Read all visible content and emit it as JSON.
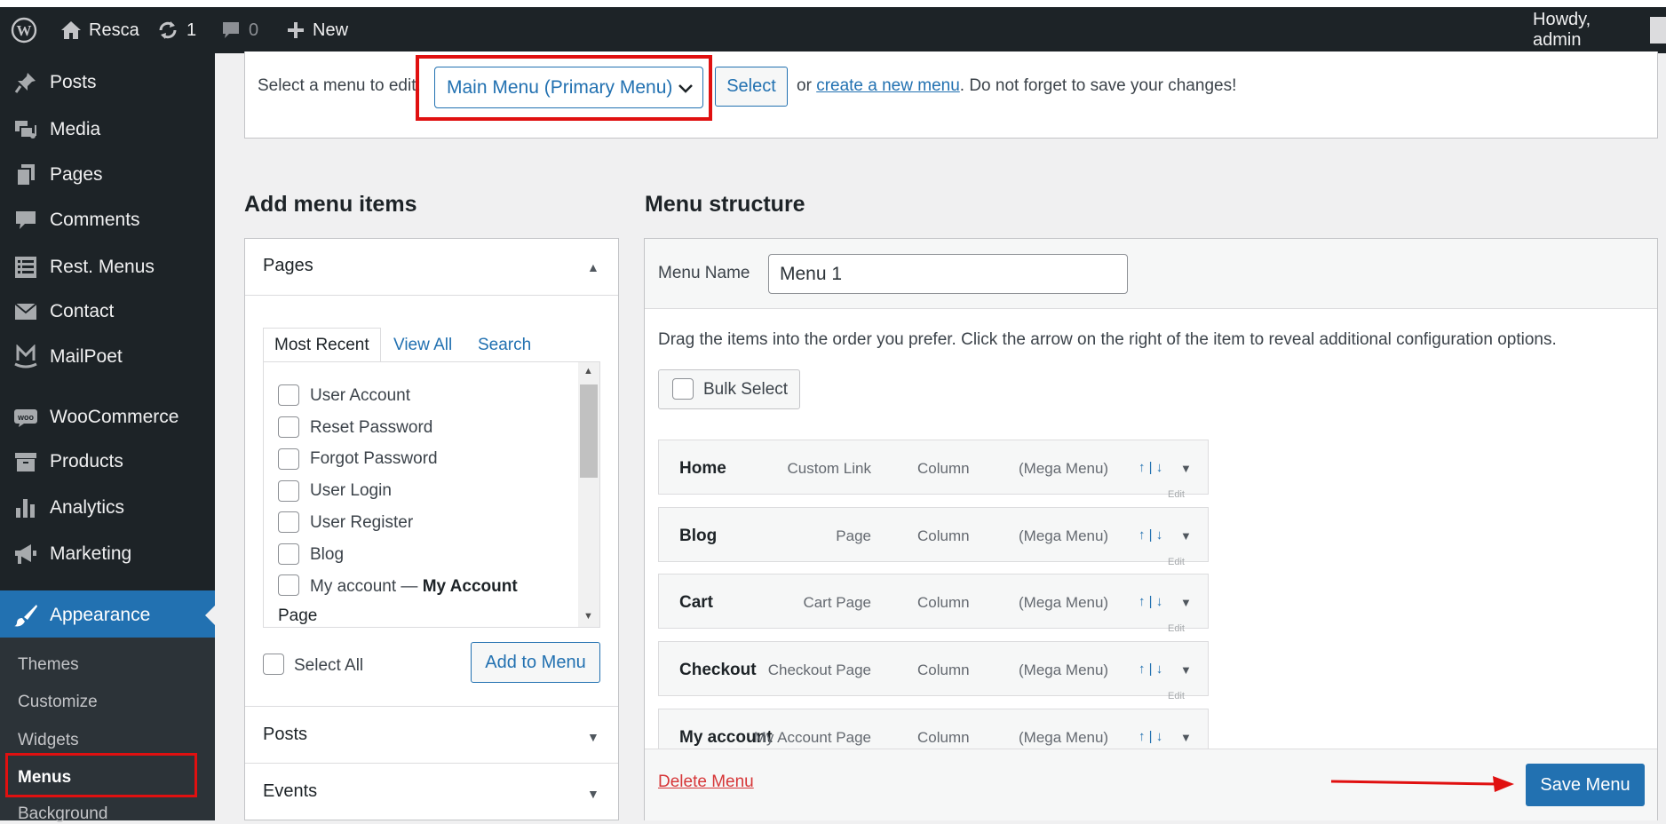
{
  "admin_bar": {
    "site_name": "Resca",
    "updates_count": "1",
    "comments_count": "0",
    "new_label": "New",
    "greeting": "Howdy, admin"
  },
  "sidebar": {
    "items": [
      {
        "label": "Posts",
        "icon": "pushpin-icon"
      },
      {
        "label": "Media",
        "icon": "media-icon"
      },
      {
        "label": "Pages",
        "icon": "pages-icon"
      },
      {
        "label": "Comments",
        "icon": "comments-icon"
      },
      {
        "label": "Rest. Menus",
        "icon": "list-icon"
      },
      {
        "label": "Contact",
        "icon": "envelope-icon"
      },
      {
        "label": "MailPoet",
        "icon": "mailpoet-icon"
      },
      {
        "label": "WooCommerce",
        "icon": "woo-icon"
      },
      {
        "label": "Products",
        "icon": "archive-icon"
      },
      {
        "label": "Analytics",
        "icon": "bar-chart-icon"
      },
      {
        "label": "Marketing",
        "icon": "megaphone-icon"
      },
      {
        "label": "Appearance",
        "icon": "brush-icon"
      }
    ],
    "submenu": [
      "Themes",
      "Customize",
      "Widgets",
      "Menus",
      "Background"
    ]
  },
  "menu_select": {
    "label": "Select a menu to edit:",
    "selected": "Main Menu (Primary Menu)",
    "select_button": "Select",
    "or_text": "or",
    "create_link": "create a new menu",
    "reminder": ". Do not forget to save your changes!"
  },
  "add_items": {
    "heading": "Add menu items",
    "pages_title": "Pages",
    "tabs": [
      "Most Recent",
      "View All",
      "Search"
    ],
    "pages": [
      "User Account",
      "Reset Password",
      "Forgot Password",
      "User Login",
      "User Register",
      "Blog",
      "My account — "
    ],
    "my_account_bold": "My Account",
    "page_wrap": "Page",
    "select_all": "Select All",
    "add_button": "Add to Menu",
    "posts_title": "Posts",
    "events_title": "Events"
  },
  "structure": {
    "heading": "Menu structure",
    "menu_name_label": "Menu Name",
    "menu_name_value": "Menu 1",
    "drag_hint": "Drag the items into the order you prefer. Click the arrow on the right of the item to reveal additional configuration options.",
    "bulk_select": "Bulk Select",
    "items": [
      {
        "title": "Home",
        "type": "Custom Link",
        "col": "Column",
        "mega": "(Mega Menu)"
      },
      {
        "title": "Blog",
        "type": "Page",
        "col": "Column",
        "mega": "(Mega Menu)"
      },
      {
        "title": "Cart",
        "type": "Cart Page",
        "col": "Column",
        "mega": "(Mega Menu)"
      },
      {
        "title": "Checkout",
        "type": "Checkout Page",
        "col": "Column",
        "mega": "(Mega Menu)"
      },
      {
        "title": "My account",
        "type": "My Account Page",
        "col": "Column",
        "mega": "(Mega Menu)"
      }
    ],
    "move_text": "↑ | ↓",
    "edit_text": "Edit",
    "delete_menu": "Delete Menu",
    "save_menu": "Save Menu"
  },
  "colors": {
    "admin_dark": "#1d2327",
    "wp_blue": "#2271b1",
    "highlight_red": "#e01010"
  }
}
